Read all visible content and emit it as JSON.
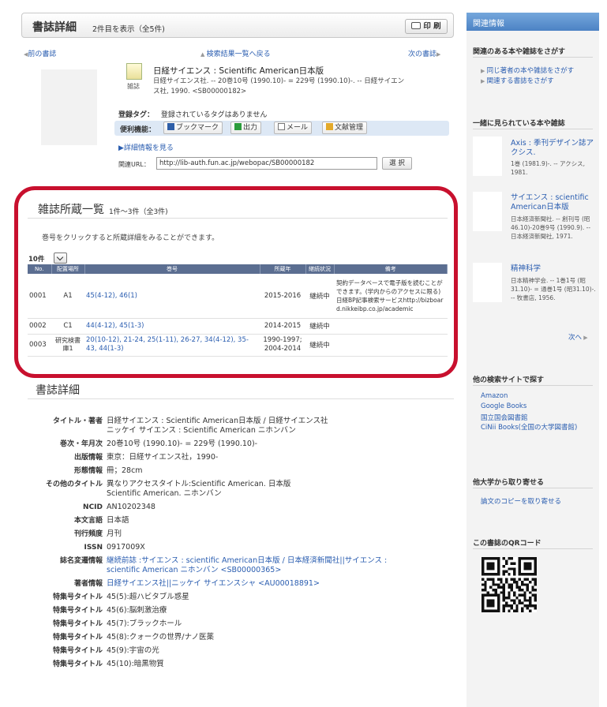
{
  "header": {
    "title": "書誌詳細",
    "count_text": "2件目を表示（全5件)",
    "print_label": "印 刷"
  },
  "nav": {
    "prev": "前の書誌",
    "back": "検索結果一覧へ戻る",
    "next": "次の書誌"
  },
  "book": {
    "icon_label": "雑誌",
    "title": "日経サイエンス : Scientific American日本版",
    "desc_line1": "日経サイエンス社. -- 20巻10号 (1990.10)- = 229号 (1990.10)-. -- 日経サイエン",
    "desc_line2": "ス社, 1990. <SB00000182>"
  },
  "tags": {
    "label": "登録タグ：",
    "value": "登録されているタグはありません"
  },
  "tools": {
    "label": "便利機能：",
    "bookmark": "ブックマーク",
    "output": "出力",
    "mail": "メール",
    "ref": "文献管理"
  },
  "detail_link": "▶詳細情報を見る",
  "url": {
    "label": "関連URL：",
    "value": "http://lib-auth.fun.ac.jp/webopac/SB00000182",
    "select": "選 択"
  },
  "holdings": {
    "title": "雑誌所蔵一覧",
    "count": "1件～3件（全3件)",
    "note": "巻号をクリックすると所蔵詳細をみることができます。",
    "per_page": "10件",
    "headers": [
      "No.",
      "配置場所",
      "巻号",
      "所蔵年",
      "継続状況",
      "備考"
    ],
    "rows": [
      {
        "no": "0001",
        "loc": "A1",
        "vol": "45(4-12), 46(1)",
        "year": "2015-2016",
        "status": "継続中",
        "note": "契約データベースで電子版を読むことができます。(学内からのアクセスに限る)日経BP記事検索サービスhttp://bizboard.nikkeibp.co.jp/academic"
      },
      {
        "no": "0002",
        "loc": "C1",
        "vol": "44(4-12), 45(1-3)",
        "year": "2014-2015",
        "status": "継続中",
        "note": ""
      },
      {
        "no": "0003",
        "loc": "研究検書庫1",
        "vol": "20(10-12), 21-24, 25(1-11), 26-27, 34(4-12), 35-43, 44(1-3)",
        "year": "1990-1997;2004-2014",
        "status": "継続中",
        "note": ""
      }
    ]
  },
  "biblio": {
    "title": "書誌詳細",
    "rows": [
      {
        "k": "タイトル・著者",
        "v": "日経サイエンス : Scientific American日本版 / 日経サイエンス社",
        "v2": "ニッケイ サイエンス : Scientific American ニホンバン",
        "link": false
      },
      {
        "k": "巻次・年月次",
        "v": "20巻10号 (1990.10)- = 229号 (1990.10)-",
        "link": false
      },
      {
        "k": "出版情報",
        "v": "東京：日経サイエンス社，1990-",
        "link": false
      },
      {
        "k": "形態情報",
        "v": "冊；28cm",
        "link": false
      },
      {
        "k": "その他のタイトル",
        "v": "異なりアクセスタイトル:Scientific American. 日本版",
        "v2": "Scientific American. ニホンバン",
        "link": false
      },
      {
        "k": "NCID",
        "v": "AN10202348",
        "link": false
      },
      {
        "k": "本文言語",
        "v": "日本語",
        "link": false
      },
      {
        "k": "刊行頻度",
        "v": "月刊",
        "link": false
      },
      {
        "k": "ISSN",
        "v": "0917009X",
        "link": false
      },
      {
        "k": "誌名変遷情報",
        "v": "継続前誌 :サイエンス : scientific American日本版 / 日本経済新聞社||サイエンス :",
        "v2": "scientific American ニホンバン <SB00000365>",
        "link": true
      },
      {
        "k": "著者情報",
        "v": "日経サイエンス社||ニッケイ サイエンスシャ <AU00018891>",
        "link": true
      },
      {
        "k": "特集号タイトル",
        "v": "45(5):超ハビタブル惑星",
        "link": false
      },
      {
        "k": "特集号タイトル",
        "v": "45(6):脳刺激治療",
        "link": false
      },
      {
        "k": "特集号タイトル",
        "v": "45(7):ブラックホール",
        "link": false
      },
      {
        "k": "特集号タイトル",
        "v": "45(8):クォークの世界/ナノ医薬",
        "link": false
      },
      {
        "k": "特集号タイトル",
        "v": "45(9):宇宙の光",
        "link": false
      },
      {
        "k": "特集号タイトル",
        "v": "45(10):暗黒物質",
        "link": false
      }
    ]
  },
  "sidebar": {
    "header": "関連情報",
    "sec1": "関連のある本や雑誌をさがす",
    "sec1_links": [
      "同じ著者の本や雑誌をさがす",
      "関連する書誌をさがす"
    ],
    "sec2": "一緒に見られている本や雑誌",
    "items": [
      {
        "title": "Axis : 季刊デザイン誌アクシス.",
        "desc": "1巻 (1981.9)-. -- アクシス, 1981."
      },
      {
        "title": "サイエンス : scientific American日本版",
        "desc": "日本経済新聞社. -- 創刊号 (昭46.10)-20巻9号 (1990.9). -- 日本経済新聞社, 1971."
      },
      {
        "title": "精神科学",
        "desc": "日本精神学会. -- 1巻1号 (昭31.10)- = 通巻1号 (昭31.10)-. -- 牧書店, 1956."
      }
    ],
    "next": "次へ",
    "sec3": "他の検索サイトで探す",
    "sec3_links": [
      "Amazon",
      "Google Books",
      "国立国会図書館",
      "CiNii Books(全国の大学図書館)"
    ],
    "sec4": "他大学から取り寄せる",
    "sec4_link": "論文のコピーを取り寄せる",
    "sec5": "この書誌のQRコード"
  }
}
